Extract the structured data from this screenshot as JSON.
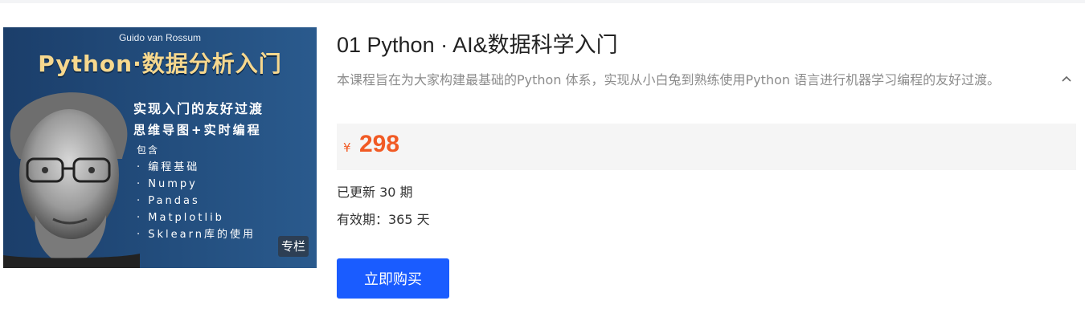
{
  "cover": {
    "author": "Guido van Rossum",
    "title": "Python·数据分析入门",
    "line1": "实现入门的友好过渡",
    "line2": "思维导图+实时编程",
    "contains_label": "包含",
    "items": [
      "· 编程基础",
      "· Numpy",
      "· Pandas",
      "· Matplotlib",
      "· Sklearn库的使用"
    ],
    "badge": "专栏"
  },
  "course": {
    "title": "01 Python · AI&数据科学入门",
    "description": "本课程旨在为大家构建最基础的Python 体系，实现从小白兔到熟练使用Python 语言进行机器学习编程的友好过渡。",
    "collapse_icon": "chevron-up-icon",
    "price": {
      "currency": "¥",
      "amount": "298"
    },
    "updated": "已更新 30 期",
    "validity": "有效期：365 天",
    "buy_label": "立即购买"
  },
  "colors": {
    "accent": "#1a5cff",
    "price": "#f15a24",
    "price_bg": "#f5f5f5"
  }
}
